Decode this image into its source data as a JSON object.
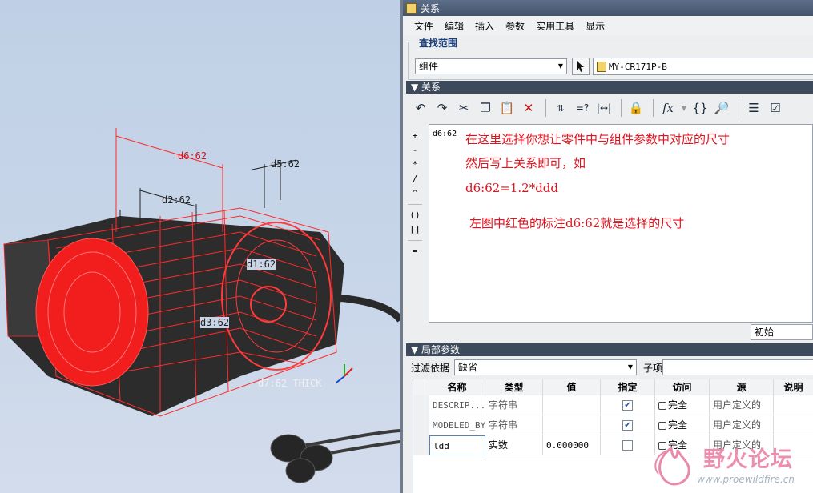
{
  "window": {
    "title": "关系"
  },
  "menu": [
    "文件",
    "编辑",
    "插入",
    "参数",
    "实用工具",
    "显示"
  ],
  "scope": {
    "group_label": "查找范围",
    "type_value": "组件",
    "model_name": "MY-CR171P-B"
  },
  "relations": {
    "section_title": "关系",
    "code": "d6:62",
    "note_lines": [
      "在这里选择你想让零件中与组件参数中对应的尺寸",
      "然后写上关系即可，如",
      "d6:62=1.2*ddd",
      "左图中红色的标注d6:62就是选择的尺寸"
    ],
    "operators": [
      "+",
      "-",
      "*",
      "/",
      "^",
      "()",
      "[]",
      "="
    ],
    "status_value": "初始"
  },
  "toolbar_icons": [
    "undo-icon",
    "redo-icon",
    "cut-icon",
    "copy-icon",
    "paste-icon",
    "delete-icon",
    "sort-icon",
    "evaluate-icon",
    "dimension-icon",
    "lock-file-icon",
    "function-icon",
    "brackets-icon",
    "verify-icon",
    "list-icon",
    "check-icon"
  ],
  "local_params": {
    "section_title": "局部参数",
    "filter_label": "过滤依据",
    "filter_value": "缺省",
    "subitem_label": "子项",
    "columns": [
      "名称",
      "类型",
      "值",
      "指定",
      "访问",
      "源",
      "说明"
    ],
    "rows": [
      {
        "name": "DESCRIP...",
        "type": "字符串",
        "value": "",
        "designated": true,
        "access": "完全",
        "source": "用户定义的",
        "note": ""
      },
      {
        "name": "MODELED_BY",
        "type": "字符串",
        "value": "",
        "designated": true,
        "access": "完全",
        "source": "用户定义的",
        "note": ""
      },
      {
        "name": "ldd",
        "type": "实数",
        "value": "0.000000",
        "designated": false,
        "access": "完全",
        "source": "用户定义的",
        "note": ""
      }
    ]
  },
  "viewport": {
    "dims": [
      "d6:62",
      "d2:62",
      "d5:62",
      "d1:62",
      "d3:62",
      "d7:62 THICK"
    ]
  },
  "watermark": {
    "text": "野火论坛",
    "url": "www.proewildfire.cn"
  },
  "colors": {
    "annotation_red": "#e0141e",
    "section_bar": "#3d4a5c",
    "title_bar": "#4f607a"
  }
}
